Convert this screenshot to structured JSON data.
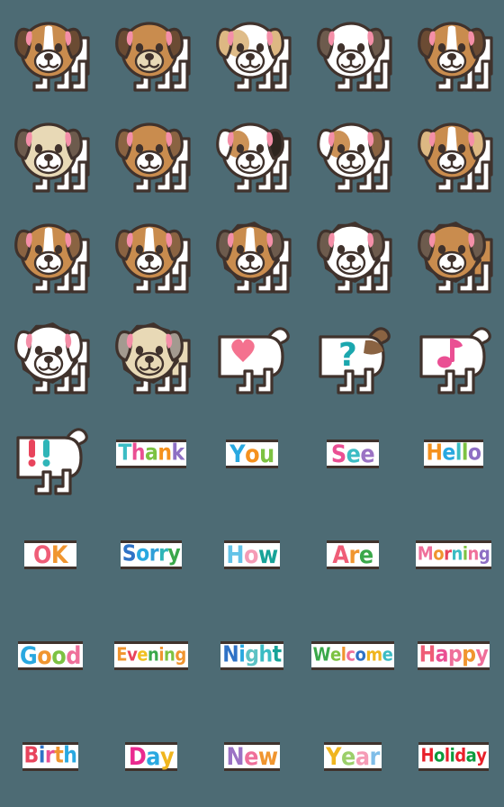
{
  "page": {
    "title": "Dog Emoji Sticker Set",
    "background_color": "#4d6b74",
    "columns": 5,
    "rows": 8,
    "outline_color": "#40322c",
    "card_background": "#ffffff"
  },
  "palette": {
    "outline": "#40322c",
    "white_fur": "#ffffff",
    "shadow_fur": "#efefef",
    "tan": "#c98c4e",
    "tan_light": "#ddb883",
    "tan_pale": "#e4cfa8",
    "brown_dark": "#6b4b33",
    "brown_mid": "#8a6342",
    "brown_grey": "#6d5b4d",
    "cream": "#e8d9b6",
    "grey": "#a39a90",
    "ear_pink": "#f48fa8",
    "nose": "#40322c",
    "black_patch": "#2e251f"
  },
  "stickers": [
    {
      "index": 1,
      "row": 1,
      "col": 1,
      "kind": "dog-face",
      "name": "dog-tan-blaze",
      "body": "white",
      "face": "tan",
      "ear_left": "brown_dark",
      "ear_right": "brown_dark",
      "blaze": true,
      "fluffy": false,
      "muzzle": "white"
    },
    {
      "index": 2,
      "row": 1,
      "col": 2,
      "kind": "dog-face",
      "name": "dog-full-tan",
      "body": "white",
      "face": "tan",
      "ear_left": "brown_dark",
      "ear_right": "brown_dark",
      "blaze": false,
      "fluffy": false,
      "muzzle": "cream"
    },
    {
      "index": 3,
      "row": 1,
      "col": 3,
      "kind": "dog-face",
      "name": "dog-white-tan-ears",
      "body": "white",
      "face": "white",
      "ear_left": "tan_light",
      "ear_right": "tan_light",
      "blaze": false,
      "fluffy": false,
      "muzzle": "white",
      "patch_left": true
    },
    {
      "index": 4,
      "row": 1,
      "col": 4,
      "kind": "dog-face",
      "name": "dog-white-dark-ears",
      "body": "white",
      "face": "white",
      "ear_left": "brown_grey",
      "ear_right": "brown_grey",
      "blaze": false,
      "fluffy": false,
      "muzzle": "white"
    },
    {
      "index": 5,
      "row": 1,
      "col": 5,
      "kind": "dog-face",
      "name": "dog-tan-white-blaze",
      "body": "white",
      "face": "tan",
      "ear_left": "brown_dark",
      "ear_right": "brown_dark",
      "blaze": true,
      "fluffy": false,
      "muzzle": "white"
    },
    {
      "index": 6,
      "row": 2,
      "col": 1,
      "kind": "dog-face",
      "name": "dog-cream-dark-ears",
      "body": "white",
      "face": "cream",
      "ear_left": "brown_grey",
      "ear_right": "brown_grey",
      "blaze": false,
      "fluffy": false,
      "muzzle": "white"
    },
    {
      "index": 7,
      "row": 2,
      "col": 2,
      "kind": "dog-face",
      "name": "dog-tan-half-face",
      "body": "white",
      "face": "tan",
      "ear_left": "brown_mid",
      "ear_right": "brown_mid",
      "blaze": false,
      "fluffy": false,
      "muzzle": "white",
      "half_face": true
    },
    {
      "index": 8,
      "row": 2,
      "col": 3,
      "kind": "dog-face",
      "name": "dog-white-black-patch",
      "body": "white",
      "face": "white",
      "ear_left": "white",
      "ear_right": "black_patch",
      "blaze": false,
      "fluffy": false,
      "muzzle": "white",
      "patch_left": true
    },
    {
      "index": 9,
      "row": 2,
      "col": 4,
      "kind": "dog-face",
      "name": "dog-white-tan-patch",
      "body": "white",
      "face": "white",
      "ear_left": "white",
      "ear_right": "brown_mid",
      "blaze": false,
      "fluffy": false,
      "muzzle": "white",
      "patch_left": true
    },
    {
      "index": 10,
      "row": 2,
      "col": 5,
      "kind": "dog-face",
      "name": "dog-tan-long-ears",
      "body": "white",
      "face": "tan",
      "ear_left": "tan_light",
      "ear_right": "tan_light",
      "blaze": true,
      "fluffy": false,
      "muzzle": "white"
    },
    {
      "index": 11,
      "row": 3,
      "col": 1,
      "kind": "dog-face",
      "name": "dog-tan-white-split",
      "body": "white",
      "face": "tan",
      "ear_left": "brown_mid",
      "ear_right": "brown_mid",
      "blaze": true,
      "fluffy": false,
      "muzzle": "white"
    },
    {
      "index": 12,
      "row": 3,
      "col": 2,
      "kind": "dog-face",
      "name": "dog-tan-wide-blaze",
      "body": "white",
      "face": "tan",
      "ear_left": "brown_mid",
      "ear_right": "brown_mid",
      "blaze": true,
      "fluffy": false,
      "muzzle": "white"
    },
    {
      "index": 13,
      "row": 3,
      "col": 3,
      "kind": "dog-face",
      "name": "dog-tan-shaggy",
      "body": "white",
      "face": "tan",
      "ear_left": "brown_grey",
      "ear_right": "brown_grey",
      "blaze": true,
      "fluffy": true,
      "muzzle": "white"
    },
    {
      "index": 14,
      "row": 3,
      "col": 4,
      "kind": "dog-face",
      "name": "dog-white-shaggy",
      "body": "white",
      "face": "white",
      "ear_left": "brown_grey",
      "ear_right": "brown_grey",
      "blaze": false,
      "fluffy": true,
      "muzzle": "white"
    },
    {
      "index": 15,
      "row": 3,
      "col": 5,
      "kind": "dog-face",
      "name": "dog-tan-full-shaggy",
      "body": "tan",
      "face": "tan",
      "ear_left": "brown_grey",
      "ear_right": "brown_grey",
      "blaze": false,
      "fluffy": true,
      "muzzle": "white"
    },
    {
      "index": 16,
      "row": 4,
      "col": 1,
      "kind": "dog-face",
      "name": "dog-white-fluffy",
      "body": "white",
      "face": "white",
      "ear_left": "white",
      "ear_right": "white",
      "blaze": false,
      "fluffy": true,
      "muzzle": "white"
    },
    {
      "index": 17,
      "row": 4,
      "col": 2,
      "kind": "dog-face",
      "name": "dog-cream-fluffy",
      "body": "cream",
      "face": "cream",
      "ear_left": "grey",
      "ear_right": "grey",
      "blaze": false,
      "fluffy": true,
      "muzzle": "cream"
    },
    {
      "index": 18,
      "row": 4,
      "col": 3,
      "kind": "dog-rear",
      "name": "dog-rear-heart",
      "symbol": "heart",
      "symbol_color": "#f4728f",
      "tail": "white",
      "rump": "white"
    },
    {
      "index": 19,
      "row": 4,
      "col": 4,
      "kind": "dog-rear",
      "name": "dog-rear-question",
      "symbol": "question",
      "symbol_color": "#1ba7ae",
      "tail": "brown",
      "rump": "white"
    },
    {
      "index": 20,
      "row": 4,
      "col": 5,
      "kind": "dog-rear",
      "name": "dog-rear-music-note",
      "symbol": "note",
      "symbol_color": "#ea4f93",
      "tail": "white",
      "rump": "white"
    },
    {
      "index": 21,
      "row": 5,
      "col": 1,
      "kind": "dog-rear",
      "name": "dog-rear-exclamation",
      "symbol": "double-exclamation",
      "symbol_color": "#e8445c",
      "symbol_color2": "#2fb5b8",
      "tail": "white",
      "rump": "white"
    },
    {
      "index": 22,
      "row": 5,
      "col": 2,
      "kind": "text-card",
      "name": "card-thank",
      "text": "Thank",
      "letters": [
        {
          "c": "T",
          "color": "#3bbcc4"
        },
        {
          "c": "h",
          "color": "#ea4f93"
        },
        {
          "c": "a",
          "color": "#7dc242"
        },
        {
          "c": "n",
          "color": "#f5911e"
        },
        {
          "c": "k",
          "color": "#8e6fc4"
        }
      ]
    },
    {
      "index": 23,
      "row": 5,
      "col": 3,
      "kind": "text-card",
      "name": "card-you",
      "text": "You",
      "letters": [
        {
          "c": "Y",
          "color": "#29a8e0"
        },
        {
          "c": "o",
          "color": "#f5911e"
        },
        {
          "c": "u",
          "color": "#7dc242"
        }
      ]
    },
    {
      "index": 24,
      "row": 5,
      "col": 4,
      "kind": "text-card",
      "name": "card-see",
      "text": "See",
      "letters": [
        {
          "c": "S",
          "color": "#ea4f93"
        },
        {
          "c": "e",
          "color": "#3bbcc4"
        },
        {
          "c": "e",
          "color": "#9b72c4"
        }
      ]
    },
    {
      "index": 25,
      "row": 5,
      "col": 5,
      "kind": "text-card",
      "name": "card-hello",
      "text": "Hello",
      "letters": [
        {
          "c": "H",
          "color": "#f5911e"
        },
        {
          "c": "e",
          "color": "#29a8e0"
        },
        {
          "c": "l",
          "color": "#3bbcc4"
        },
        {
          "c": "l",
          "color": "#7dc242"
        },
        {
          "c": "o",
          "color": "#8e6fc4"
        }
      ]
    },
    {
      "index": 26,
      "row": 6,
      "col": 1,
      "kind": "text-card",
      "name": "card-ok",
      "text": "OK",
      "letters": [
        {
          "c": "O",
          "color": "#ef5d77"
        },
        {
          "c": "K",
          "color": "#f0952f"
        }
      ]
    },
    {
      "index": 27,
      "row": 6,
      "col": 2,
      "kind": "text-card",
      "name": "card-sorry",
      "text": "Sorry",
      "letters": [
        {
          "c": "S",
          "color": "#2f72c6"
        },
        {
          "c": "o",
          "color": "#29a8e0"
        },
        {
          "c": "r",
          "color": "#2f9fd8"
        },
        {
          "c": "r",
          "color": "#2fb5b8"
        },
        {
          "c": "y",
          "color": "#3aa84a"
        }
      ]
    },
    {
      "index": 28,
      "row": 6,
      "col": 3,
      "kind": "text-card",
      "name": "card-how",
      "text": "How",
      "letters": [
        {
          "c": "H",
          "color": "#63c3e8"
        },
        {
          "c": "o",
          "color": "#f59bb5"
        },
        {
          "c": "w",
          "color": "#17a398"
        }
      ]
    },
    {
      "index": 29,
      "row": 6,
      "col": 4,
      "kind": "text-card",
      "name": "card-are",
      "text": "Are",
      "letters": [
        {
          "c": "A",
          "color": "#ef5d77"
        },
        {
          "c": "r",
          "color": "#f0952f"
        },
        {
          "c": "e",
          "color": "#3aa84a"
        }
      ]
    },
    {
      "index": 30,
      "row": 6,
      "col": 5,
      "kind": "text-card",
      "name": "card-morning",
      "text": "Morning",
      "letters": [
        {
          "c": "M",
          "color": "#ef6f9a"
        },
        {
          "c": "o",
          "color": "#f0952f"
        },
        {
          "c": "r",
          "color": "#e8445c"
        },
        {
          "c": "n",
          "color": "#3bbcc4"
        },
        {
          "c": "i",
          "color": "#7dc242"
        },
        {
          "c": "n",
          "color": "#ef6f9a"
        },
        {
          "c": "g",
          "color": "#8e6fc4"
        }
      ]
    },
    {
      "index": 31,
      "row": 7,
      "col": 1,
      "kind": "text-card",
      "name": "card-good",
      "text": "Good",
      "letters": [
        {
          "c": "G",
          "color": "#29a8e0"
        },
        {
          "c": "o",
          "color": "#f0952f"
        },
        {
          "c": "o",
          "color": "#7dc242"
        },
        {
          "c": "d",
          "color": "#ef6f9a"
        }
      ]
    },
    {
      "index": 32,
      "row": 7,
      "col": 2,
      "kind": "text-card",
      "name": "card-evening",
      "text": "Evening",
      "letters": [
        {
          "c": "E",
          "color": "#f0952f"
        },
        {
          "c": "v",
          "color": "#e8445c"
        },
        {
          "c": "e",
          "color": "#f0c020"
        },
        {
          "c": "n",
          "color": "#3aa84a"
        },
        {
          "c": "i",
          "color": "#f0952f"
        },
        {
          "c": "n",
          "color": "#7dc242"
        },
        {
          "c": "g",
          "color": "#f0952f"
        }
      ]
    },
    {
      "index": 33,
      "row": 7,
      "col": 3,
      "kind": "text-card",
      "name": "card-night",
      "text": "Night",
      "letters": [
        {
          "c": "N",
          "color": "#2f72c6"
        },
        {
          "c": "i",
          "color": "#29a8e0"
        },
        {
          "c": "g",
          "color": "#5cc2c4"
        },
        {
          "c": "h",
          "color": "#3bbcc4"
        },
        {
          "c": "t",
          "color": "#17a398"
        }
      ]
    },
    {
      "index": 34,
      "row": 7,
      "col": 4,
      "kind": "text-card",
      "name": "card-welcome",
      "text": "Welcome",
      "letters": [
        {
          "c": "W",
          "color": "#3aa84a"
        },
        {
          "c": "e",
          "color": "#7dc242"
        },
        {
          "c": "l",
          "color": "#f0952f"
        },
        {
          "c": "c",
          "color": "#ef6f9a"
        },
        {
          "c": "o",
          "color": "#2f72c6"
        },
        {
          "c": "m",
          "color": "#f0b51e"
        },
        {
          "c": "e",
          "color": "#3bbcc4"
        }
      ]
    },
    {
      "index": 35,
      "row": 7,
      "col": 5,
      "kind": "text-card",
      "name": "card-happy",
      "text": "Happy",
      "letters": [
        {
          "c": "H",
          "color": "#ef5d77"
        },
        {
          "c": "a",
          "color": "#ea4f93"
        },
        {
          "c": "p",
          "color": "#ef6f9a"
        },
        {
          "c": "p",
          "color": "#f0952f"
        },
        {
          "c": "y",
          "color": "#ef6f9a"
        }
      ]
    },
    {
      "index": 36,
      "row": 8,
      "col": 1,
      "kind": "text-card",
      "name": "card-birth",
      "text": "Birth",
      "letters": [
        {
          "c": "B",
          "color": "#e8445c"
        },
        {
          "c": "i",
          "color": "#2f72c6"
        },
        {
          "c": "r",
          "color": "#ea4f93"
        },
        {
          "c": "t",
          "color": "#f0952f"
        },
        {
          "c": "h",
          "color": "#29a8e0"
        }
      ]
    },
    {
      "index": 37,
      "row": 8,
      "col": 2,
      "kind": "text-card",
      "name": "card-day",
      "text": "Day",
      "letters": [
        {
          "c": "D",
          "color": "#ea2a8f"
        },
        {
          "c": "a",
          "color": "#29a8e0"
        },
        {
          "c": "y",
          "color": "#f0b51e"
        }
      ]
    },
    {
      "index": 38,
      "row": 8,
      "col": 3,
      "kind": "text-card",
      "name": "card-new",
      "text": "New",
      "letters": [
        {
          "c": "N",
          "color": "#9b72c4"
        },
        {
          "c": "e",
          "color": "#ef6f9a"
        },
        {
          "c": "w",
          "color": "#f0952f"
        }
      ]
    },
    {
      "index": 39,
      "row": 8,
      "col": 4,
      "kind": "text-card",
      "name": "card-year",
      "text": "Year",
      "letters": [
        {
          "c": "Y",
          "color": "#f0b51e"
        },
        {
          "c": "e",
          "color": "#9ccf6a"
        },
        {
          "c": "a",
          "color": "#f59bb5"
        },
        {
          "c": "r",
          "color": "#7fbde8"
        }
      ]
    },
    {
      "index": 40,
      "row": 8,
      "col": 5,
      "kind": "text-card",
      "name": "card-holiday",
      "text": "Holiday",
      "letters": [
        {
          "c": "H",
          "color": "#e8202a"
        },
        {
          "c": "o",
          "color": "#0d9b3d"
        },
        {
          "c": "l",
          "color": "#e8202a"
        },
        {
          "c": "i",
          "color": "#0d9b3d"
        },
        {
          "c": "d",
          "color": "#e8202a"
        },
        {
          "c": "a",
          "color": "#0d9b3d"
        },
        {
          "c": "y",
          "color": "#e8202a"
        }
      ]
    }
  ]
}
